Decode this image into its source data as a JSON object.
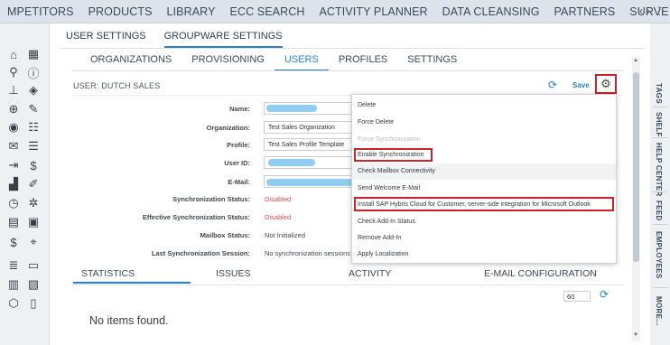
{
  "topnav": {
    "items": [
      "MPETITORS",
      "PRODUCTS",
      "LIBRARY",
      "ECC SEARCH",
      "ACTIVITY PLANNER",
      "DATA CLEANSING",
      "PARTNERS",
      "SURVE"
    ],
    "arrows": [
      "‹",
      "›",
      "⋮"
    ]
  },
  "settings_tabs": [
    "USER SETTINGS",
    "GROUPWARE SETTINGS"
  ],
  "groupware_tabs": [
    "ORGANIZATIONS",
    "PROVISIONING",
    "USERS",
    "PROFILES",
    "SETTINGS"
  ],
  "section": {
    "title": "USER: DUTCH SALES",
    "save_label": "Save"
  },
  "form": {
    "name_label": "Name:",
    "organization_label": "Organization:",
    "organization_value": "Test Sales Organization",
    "profile_label": "Profile:",
    "profile_value": "Test Sales Profile Template",
    "userid_label": "User ID:",
    "email_label": "E-Mail:",
    "sync_status_label": "Synchronization Status:",
    "sync_status_value": "Disabled",
    "eff_sync_label": "Effective Synchronization Status:",
    "eff_sync_value": "Disabled",
    "mailbox_label": "Mailbox Status:",
    "mailbox_value": "Not Initialized",
    "last_sync_label": "Last Synchronization Session:",
    "last_sync_value": "No synchronization sessions fo"
  },
  "menu": {
    "items": [
      "Delete",
      "Force Delete",
      "Force Synchronization",
      "Enable Synchronization",
      "Check Mailbox Connectivity",
      "Send Welcome E-Mail",
      "Install SAP Hybris Cloud for Customer, server-side integration for Microsoft Outlook",
      "Check Add-In Status",
      "Remove Add-In",
      "Apply Localization"
    ]
  },
  "bottom_tabs": [
    "STATISTICS",
    "ISSUES",
    "ACTIVITY",
    "E-MAIL CONFIGURATION"
  ],
  "page_size": "60",
  "empty_text": "No items found.",
  "right_rail": [
    "TAGS",
    "SHELF",
    "HELP CENTER",
    "FEED",
    "EMPLOYEES",
    "MORE..."
  ],
  "colors": {
    "accent": "#2a82c6",
    "highlight_box": "#c9232a",
    "disabled_status": "#d84b4b"
  }
}
